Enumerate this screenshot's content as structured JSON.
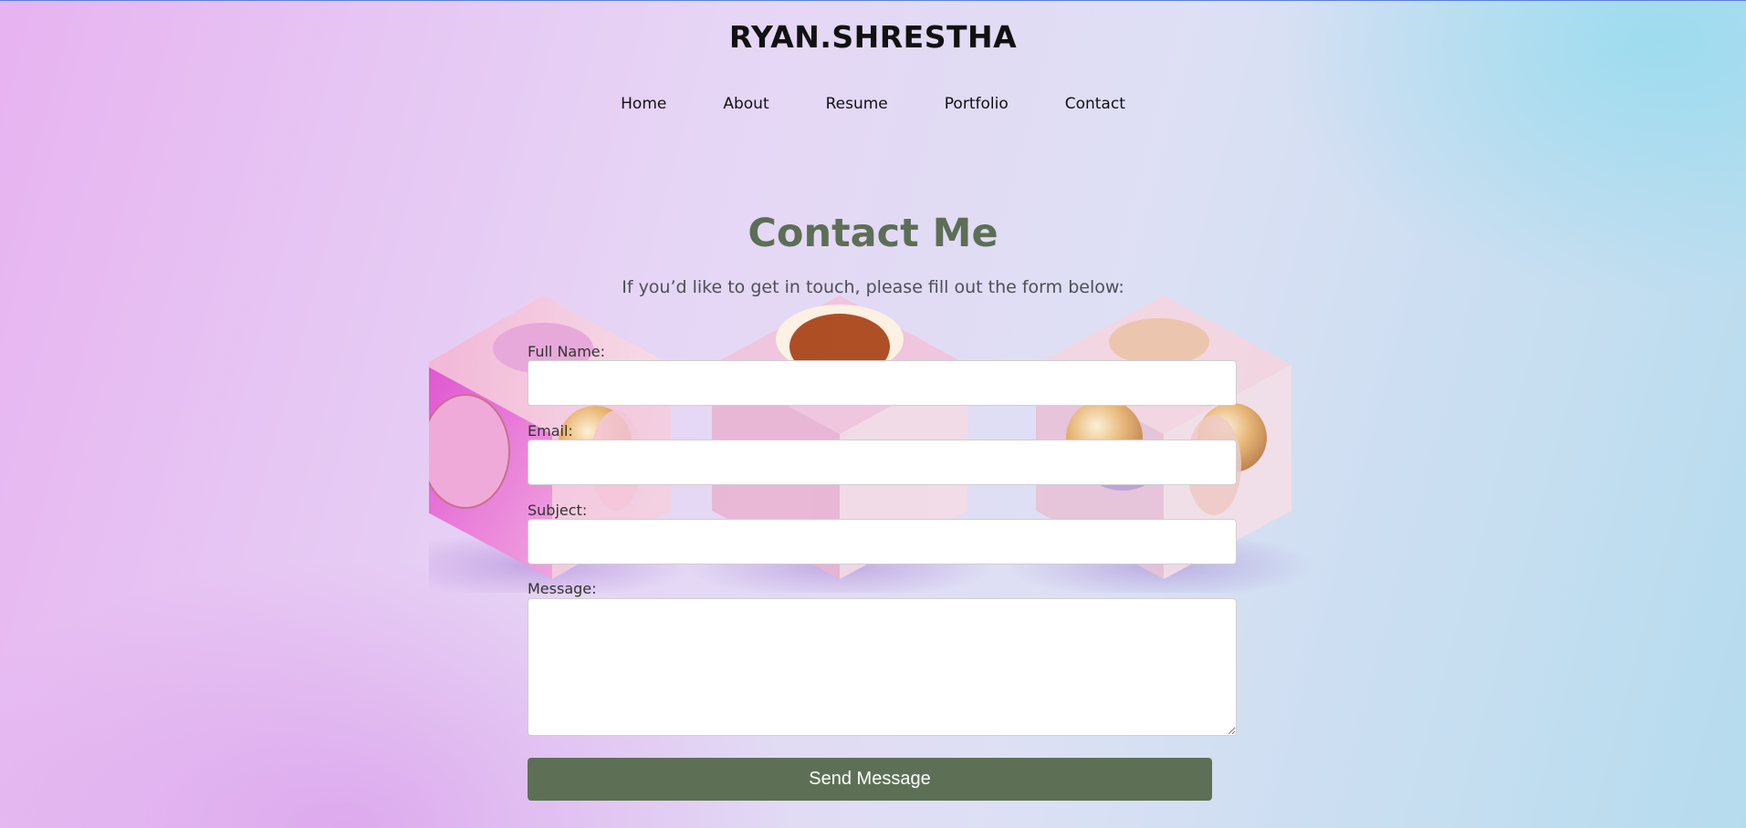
{
  "header": {
    "site_title": "RYAN.SHRESTHA"
  },
  "nav": {
    "items": [
      {
        "label": "Home"
      },
      {
        "label": "About"
      },
      {
        "label": "Resume"
      },
      {
        "label": "Portfolio"
      },
      {
        "label": "Contact"
      }
    ]
  },
  "main": {
    "heading": "Contact Me",
    "intro": "If you’d like to get in touch, please fill out the form below:"
  },
  "form": {
    "full_name": {
      "label": "Full Name:",
      "value": ""
    },
    "email": {
      "label": "Email:",
      "value": ""
    },
    "subject": {
      "label": "Subject:",
      "value": ""
    },
    "message": {
      "label": "Message:",
      "value": ""
    },
    "submit_label": "Send Message"
  },
  "colors": {
    "accent": "#5d7056",
    "heading": "#5d6e56",
    "title": "#111111",
    "background_left": "#e7b3f1",
    "background_right": "#b5dcee"
  },
  "decorations": {
    "background_art": "three pastel cubes with spheres"
  }
}
